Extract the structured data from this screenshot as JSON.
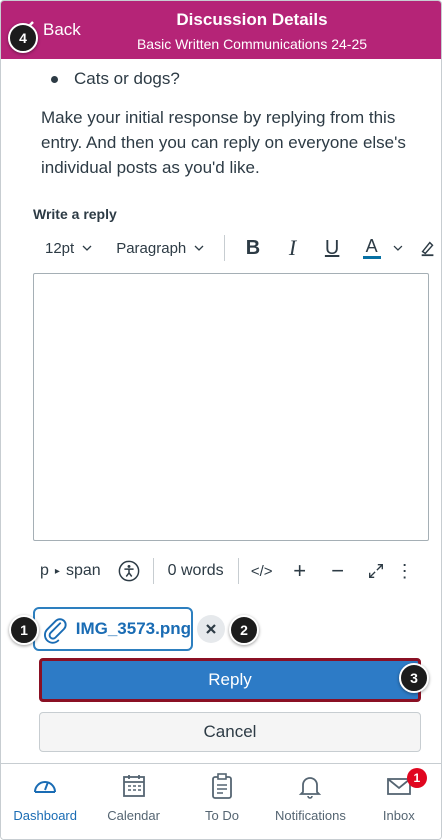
{
  "header": {
    "back_label": "Back",
    "title": "Discussion Details",
    "subtitle": "Basic Written Communications 24-25"
  },
  "content": {
    "bullet": "Cats or dogs?",
    "paragraph": "Make your initial response by replying from this entry. And then you can reply on everyone else's individual posts as you'd like."
  },
  "editor": {
    "label": "Write a reply",
    "font_size": "12pt",
    "block_format": "Paragraph",
    "toolbar": {
      "bold": "B",
      "italic": "I",
      "underline": "U",
      "text_color": "A",
      "text_color_accent": "#0770a3"
    },
    "status": {
      "path_p": "p",
      "path_span": "span",
      "word_count": "0 words",
      "html_toggle": "</>",
      "zoom_in": "+",
      "zoom_out": "−",
      "more": "⋮"
    }
  },
  "attachment": {
    "filename": "IMG_3573.png"
  },
  "buttons": {
    "reply": "Reply",
    "cancel": "Cancel"
  },
  "callouts": {
    "one": "1",
    "two": "2",
    "three": "3",
    "four": "4"
  },
  "tabbar": {
    "items": [
      {
        "label": "Dashboard",
        "icon": "dashboard-icon",
        "active": true
      },
      {
        "label": "Calendar",
        "icon": "calendar-icon",
        "active": false
      },
      {
        "label": "To Do",
        "icon": "todo-icon",
        "active": false
      },
      {
        "label": "Notifications",
        "icon": "bell-icon",
        "active": false
      },
      {
        "label": "Inbox",
        "icon": "inbox-icon",
        "active": false,
        "badge": "1"
      }
    ]
  },
  "colors": {
    "header": "#b52477",
    "reply_button": "#2d7bc6",
    "active_tab": "#1a6cb4",
    "badge": "#e0061f"
  }
}
